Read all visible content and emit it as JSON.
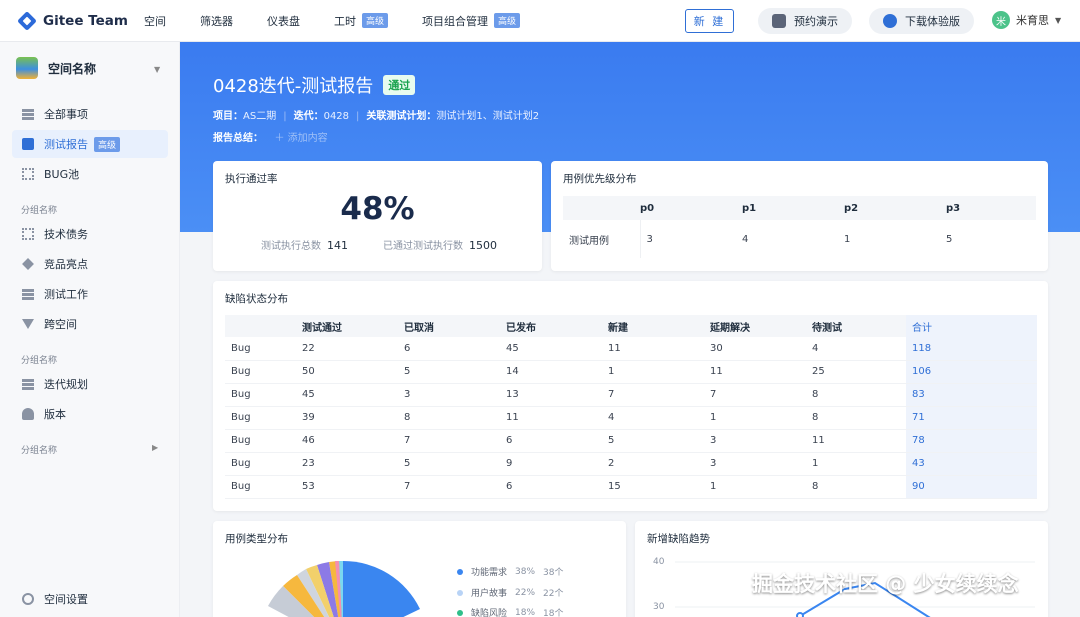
{
  "nav": {
    "brand": "Gitee Team",
    "items": [
      {
        "label": "空间",
        "badge": ""
      },
      {
        "label": "筛选器",
        "badge": ""
      },
      {
        "label": "仪表盘",
        "badge": ""
      },
      {
        "label": "工时",
        "badge": "高级"
      },
      {
        "label": "项目组合管理",
        "badge": "高级"
      }
    ],
    "new_button": "新 建",
    "demo_button": "预约演示",
    "download_button": "下载体验版",
    "user_name": "米育思",
    "user_avatar": "米"
  },
  "sidebar": {
    "space_name": "空间名称",
    "items_top": [
      {
        "label": "全部事项",
        "icon": "list-icon"
      },
      {
        "label": "测试报告",
        "icon": "report-icon",
        "badge": "高级",
        "active": true
      },
      {
        "label": "BUG池",
        "icon": "grid-icon"
      }
    ],
    "group1": "分组名称",
    "items_g1": [
      {
        "label": "技术债务",
        "icon": "grid-icon"
      },
      {
        "label": "竞品亮点",
        "icon": "tag-icon"
      },
      {
        "label": "测试工作",
        "icon": "list-icon"
      },
      {
        "label": "跨空间",
        "icon": "filter-icon"
      }
    ],
    "group2": "分组名称",
    "items_g2": [
      {
        "label": "迭代规划",
        "icon": "list-icon"
      },
      {
        "label": "版本",
        "icon": "user-icon"
      }
    ],
    "group3": "分组名称",
    "settings": "空间设置"
  },
  "report": {
    "title": "0428迭代-测试报告",
    "status": "通过",
    "project_label": "项目：",
    "project": "AS二期",
    "iteration_label": "迭代：",
    "iteration": "0428",
    "plan_label": "关联测试计划：",
    "plans": "测试计划1、测试计划2",
    "summary_label": "报告总结：",
    "summary_add": "添加内容"
  },
  "pass_rate": {
    "title": "执行通过率",
    "value": "48%",
    "total_label": "测试执行总数",
    "total": "141",
    "passed_label": "已通过测试执行数",
    "passed": "1500"
  },
  "priority": {
    "title": "用例优先级分布",
    "headers": [
      "",
      "p0",
      "p1",
      "p2",
      "p3"
    ],
    "row_label": "测试用例",
    "values": [
      "3",
      "4",
      "1",
      "5"
    ]
  },
  "defects": {
    "title": "缺陷状态分布",
    "headers": [
      "",
      "测试通过",
      "已取消",
      "已发布",
      "新建",
      "延期解决",
      "待测试",
      "合计"
    ],
    "rows": [
      [
        "Bug",
        "22",
        "6",
        "45",
        "11",
        "30",
        "4",
        "118"
      ],
      [
        "Bug",
        "50",
        "5",
        "14",
        "1",
        "11",
        "25",
        "106"
      ],
      [
        "Bug",
        "45",
        "3",
        "13",
        "7",
        "7",
        "8",
        "83"
      ],
      [
        "Bug",
        "39",
        "8",
        "11",
        "4",
        "1",
        "8",
        "71"
      ],
      [
        "Bug",
        "46",
        "7",
        "6",
        "5",
        "3",
        "11",
        "78"
      ],
      [
        "Bug",
        "23",
        "5",
        "9",
        "2",
        "3",
        "1",
        "43"
      ],
      [
        "Bug",
        "53",
        "7",
        "6",
        "15",
        "1",
        "8",
        "90"
      ]
    ]
  },
  "case_types": {
    "title": "用例类型分布",
    "legend": [
      {
        "name": "功能需求",
        "pct": "38%",
        "count": "38个",
        "color": "#3a86f0"
      },
      {
        "name": "用户故事",
        "pct": "22%",
        "count": "22个",
        "color": "#b8d3f6"
      },
      {
        "name": "缺陷风险",
        "pct": "18%",
        "count": "18个",
        "color": "#2fbf8a"
      }
    ]
  },
  "trend": {
    "title": "新增缺陷趋势",
    "y_ticks": [
      "40",
      "30"
    ]
  },
  "watermark": "掘金技术社区 @ 少女续续念"
}
